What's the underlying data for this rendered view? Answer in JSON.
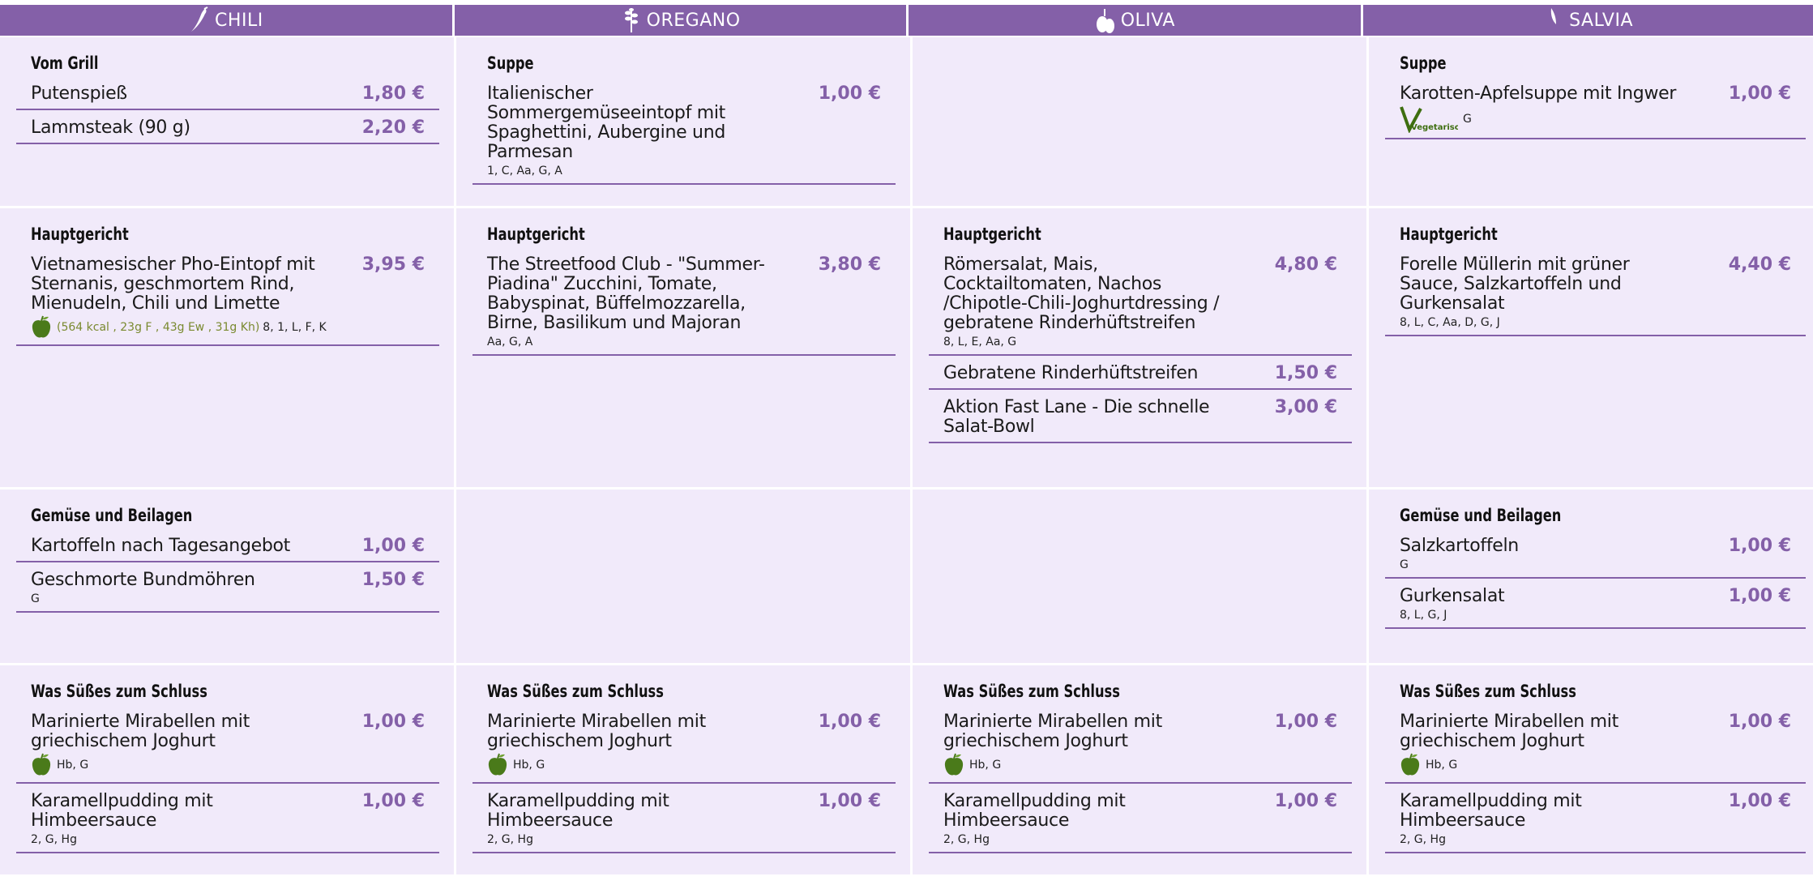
{
  "columns": [
    {
      "name": "CHILI",
      "icon": "chili-pepper-icon"
    },
    {
      "name": "OREGANO",
      "icon": "oregano-herb-icon"
    },
    {
      "name": "OLIVA",
      "icon": "olive-icon"
    },
    {
      "name": "SALVIA",
      "icon": "sage-leaf-icon"
    }
  ],
  "colors": {
    "accent": "#8460a8",
    "cell_bg": "#f1eafa",
    "nutri": "#7a8a30",
    "apple": "#4a7a1a"
  },
  "cells": {
    "chili": {
      "row1": {
        "category": "Vom Grill",
        "items": [
          {
            "name": "Putenspieß",
            "price": "1,80 €",
            "allergens": ""
          },
          {
            "name": "Lammsteak (90 g)",
            "price": "2,20 €",
            "allergens": ""
          }
        ]
      },
      "row2": {
        "category": "Hauptgericht",
        "items": [
          {
            "name": "Vietnamesischer Pho-Eintopf mit Sternanis, geschmortem Rind, Mienudeln, Chili und Limette",
            "price": "3,95 €",
            "nutrition": "(564 kcal , 23g F , 43g Ew , 31g Kh)",
            "allergens": "8, 1, L, F, K"
          }
        ]
      },
      "row3": {
        "category": "Gemüse und Beilagen",
        "items": [
          {
            "name": "Kartoffeln nach Tagesangebot",
            "price": "1,00 €",
            "allergens": ""
          },
          {
            "name": "Geschmorte Bundmöhren",
            "price": "1,50 €",
            "allergens": "G"
          }
        ]
      },
      "row4": {
        "category": "Was Süßes zum Schluss",
        "items": [
          {
            "name": "Marinierte Mirabellen mit griechischem Joghurt",
            "price": "1,00 €",
            "allergens": "Hb, G"
          },
          {
            "name": "Karamellpudding mit Himbeersauce",
            "price": "1,00 €",
            "allergens": "2, G, Hg"
          }
        ]
      }
    },
    "oregano": {
      "row1": {
        "category": "Suppe",
        "items": [
          {
            "name": "Italienischer Sommergemüseeintopf mit Spaghettini, Aubergine und Parmesan",
            "price": "1,00 €",
            "allergens": "1, C, Aa, G, A"
          }
        ]
      },
      "row2": {
        "category": "Hauptgericht",
        "items": [
          {
            "name": "The Streetfood Club - \"Summer-Piadina\" Zucchini, Tomate, Babyspinat, Büffelmozzarella, Birne, Basilikum und Majoran",
            "price": "3,80 €",
            "allergens": "Aa, G, A"
          }
        ]
      },
      "row4": {
        "category": "Was Süßes zum Schluss",
        "items": [
          {
            "name": "Marinierte Mirabellen mit griechischem Joghurt",
            "price": "1,00 €",
            "allergens": "Hb, G"
          },
          {
            "name": "Karamellpudding mit Himbeersauce",
            "price": "1,00 €",
            "allergens": "2, G, Hg"
          }
        ]
      }
    },
    "oliva": {
      "row2": {
        "category": "Hauptgericht",
        "items": [
          {
            "name": "Römersalat, Mais, Cocktailtomaten, Nachos /Chipotle-Chili-Joghurtdressing / gebratene Rinderhüftstreifen",
            "price": "4,80 €",
            "allergens": "8, L, E, Aa, G"
          },
          {
            "name": "Gebratene Rinderhüftstreifen",
            "price": "1,50 €",
            "allergens": ""
          },
          {
            "name": "Aktion Fast Lane - Die schnelle Salat-Bowl",
            "price": "3,00 €",
            "allergens": ""
          }
        ]
      },
      "row4": {
        "category": "Was Süßes zum Schluss",
        "items": [
          {
            "name": "Marinierte Mirabellen mit griechischem Joghurt",
            "price": "1,00 €",
            "allergens": "Hb, G"
          },
          {
            "name": "Karamellpudding mit Himbeersauce",
            "price": "1,00 €",
            "allergens": "2, G, Hg"
          }
        ]
      }
    },
    "salvia": {
      "row1": {
        "category": "Suppe",
        "items": [
          {
            "name": "Karotten-Apfelsuppe mit Ingwer",
            "price": "1,00 €",
            "badge": "Vegetarisch",
            "allergens": "G"
          }
        ]
      },
      "row2": {
        "category": "Hauptgericht",
        "items": [
          {
            "name": "Forelle Müllerin mit grüner Sauce, Salzkartoffeln und Gurkensalat",
            "price": "4,40 €",
            "allergens": "8, L, C, Aa, D, G, J"
          }
        ]
      },
      "row3": {
        "category": "Gemüse und Beilagen",
        "items": [
          {
            "name": "Salzkartoffeln",
            "price": "1,00 €",
            "allergens": "G"
          },
          {
            "name": "Gurkensalat",
            "price": "1,00 €",
            "allergens": "8, L, G, J"
          }
        ]
      },
      "row4": {
        "category": "Was Süßes zum Schluss",
        "items": [
          {
            "name": "Marinierte Mirabellen mit griechischem Joghurt",
            "price": "1,00 €",
            "allergens": "Hb, G"
          },
          {
            "name": "Karamellpudding mit Himbeersauce",
            "price": "1,00 €",
            "allergens": "2, G, Hg"
          }
        ]
      }
    }
  }
}
